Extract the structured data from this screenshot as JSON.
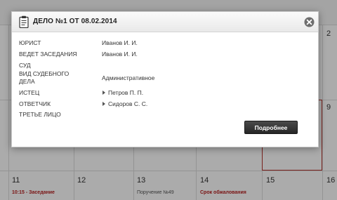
{
  "calendar": {
    "top_right_day": "2",
    "right_col_day": "9",
    "bottom_row": [
      {
        "day": "11",
        "event": "10:15 - Заседание",
        "event_style": "red"
      },
      {
        "day": "12",
        "event": "",
        "event_style": ""
      },
      {
        "day": "13",
        "event": "Поручение №49",
        "event_style": "gray"
      },
      {
        "day": "14",
        "event": "Срок обжалования",
        "event_style": "red"
      },
      {
        "day": "15",
        "event": "",
        "event_style": ""
      },
      {
        "day": "16",
        "event": "",
        "event_style": ""
      }
    ]
  },
  "dialog": {
    "title": "ДЕЛО №1 ОТ 08.02.2014",
    "fields": {
      "lawyer_label": "ЮРИСТ",
      "lawyer_value": "Иванов И. И.",
      "hearing_label": "ВЕДЕТ ЗАСЕДАНИЯ",
      "hearing_value": "Иванов И. И.",
      "court_label": "СУД",
      "case_type_label_line1": "ВИД СУДЕБНОГО",
      "case_type_label_line2": "ДЕЛА",
      "case_type_value": "Административное",
      "plaintiff_label": "ИСТЕЦ",
      "plaintiff_value": "Петров П. П.",
      "defendant_label": "ОТВЕТЧИК",
      "defendant_value": "Сидоров С. С.",
      "third_party_label": "ТРЕТЬЕ ЛИЦО"
    },
    "more_button": "Подробнее"
  },
  "colors": {
    "accent_red": "#b52121",
    "button_dark": "#2f2f2f"
  }
}
